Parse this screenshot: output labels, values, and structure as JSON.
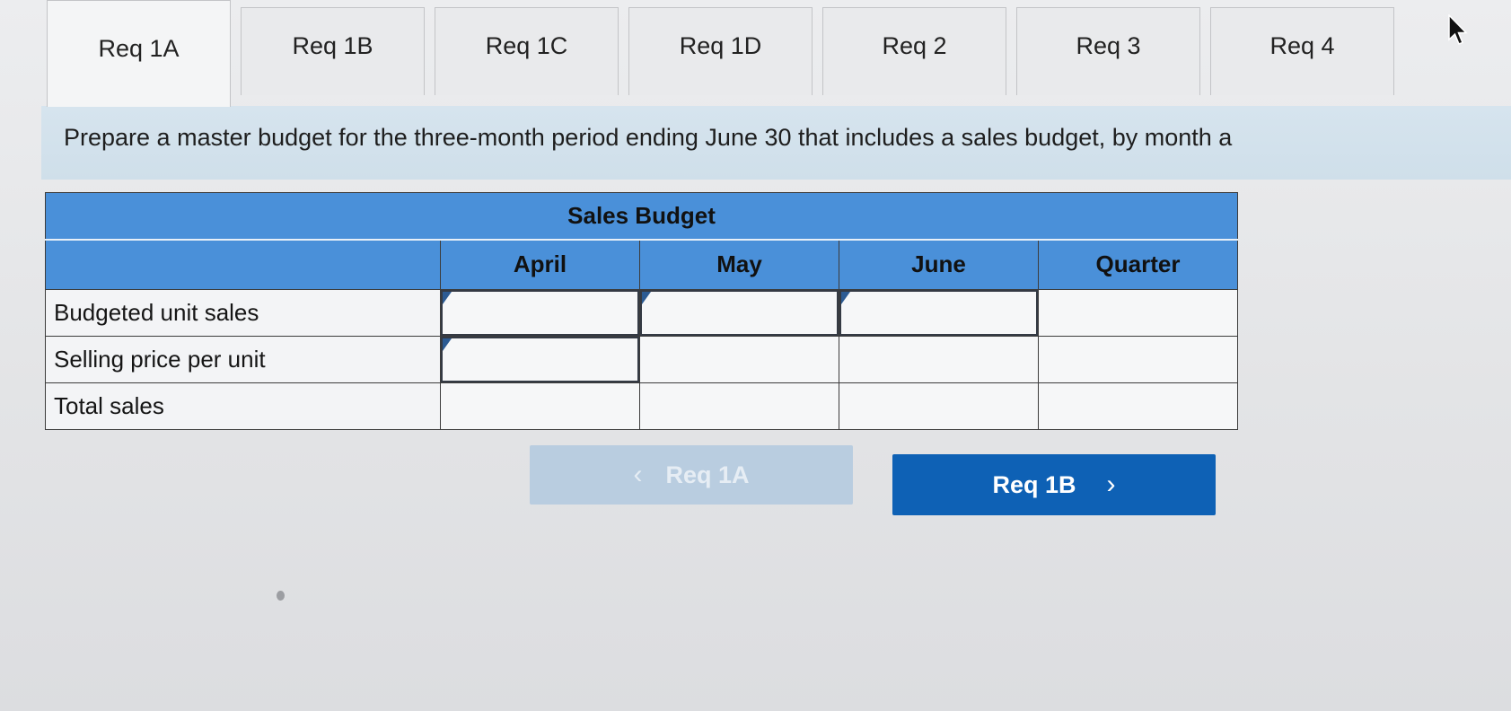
{
  "tabs": [
    {
      "label": "Req 1A",
      "active": true
    },
    {
      "label": "Req 1B",
      "active": false
    },
    {
      "label": "Req 1C",
      "active": false
    },
    {
      "label": "Req 1D",
      "active": false
    },
    {
      "label": "Req 2",
      "active": false
    },
    {
      "label": "Req 3",
      "active": false
    },
    {
      "label": "Req 4",
      "active": false
    }
  ],
  "instruction": "Prepare a master budget for the three-month period ending June 30 that includes a sales budget, by month a",
  "table": {
    "title": "Sales Budget",
    "columns": [
      "",
      "April",
      "May",
      "June",
      "Quarter"
    ],
    "rows": [
      {
        "label": "Budgeted unit sales",
        "values": [
          "",
          "",
          "",
          ""
        ]
      },
      {
        "label": "Selling price per unit",
        "values": [
          "",
          "",
          "",
          ""
        ]
      },
      {
        "label": "Total sales",
        "values": [
          "",
          "",
          "",
          ""
        ]
      }
    ]
  },
  "navigation": {
    "prev_label": "Req 1A",
    "next_label": "Req 1B",
    "prev_chevron": "‹",
    "next_chevron": "›"
  },
  "colors": {
    "header_blue": "#4a90d9",
    "instruction_bg": "#d6e4ee",
    "next_button": "#0e61b5",
    "prev_button_disabled": "#b9cde0",
    "input_marker": "#2c5b93"
  },
  "icons": {
    "cursor": "mouse-pointer-icon",
    "prev": "chevron-left-icon",
    "next": "chevron-right-icon"
  }
}
